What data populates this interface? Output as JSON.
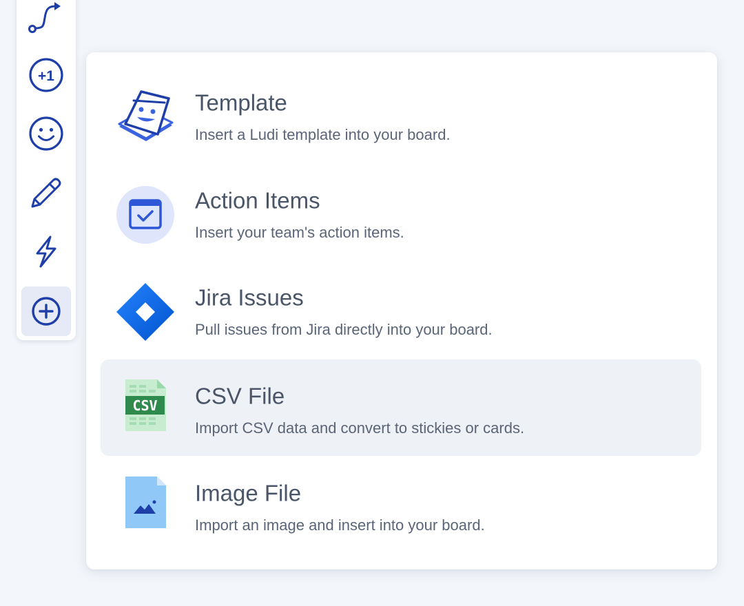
{
  "toolbar": {
    "tools": [
      {
        "name": "connector",
        "icon": "connector-arrow-icon",
        "active": false
      },
      {
        "name": "vote",
        "icon": "plus-one-icon",
        "label": "+1",
        "active": false
      },
      {
        "name": "emoji",
        "icon": "smiley-icon",
        "active": false
      },
      {
        "name": "draw",
        "icon": "pencil-icon",
        "active": false
      },
      {
        "name": "actions",
        "icon": "lightning-bolt-icon",
        "active": false
      },
      {
        "name": "insert",
        "icon": "plus-circle-icon",
        "active": true
      }
    ]
  },
  "menu": {
    "items": [
      {
        "id": "template",
        "icon": "template-sticky-icon",
        "title": "Template",
        "description": "Insert a Ludi template into your board."
      },
      {
        "id": "action-items",
        "icon": "calendar-check-icon",
        "title": "Action Items",
        "description": "Insert your team's action items."
      },
      {
        "id": "jira-issues",
        "icon": "jira-logo-icon",
        "title": "Jira Issues",
        "description": "Pull issues from Jira directly into your board."
      },
      {
        "id": "csv-file",
        "icon": "csv-file-icon",
        "icon_label": "CSV",
        "title": "CSV File",
        "description": "Import CSV data and convert to stickies or cards.",
        "highlighted": true
      },
      {
        "id": "image-file",
        "icon": "image-file-icon",
        "title": "Image File",
        "description": "Import an image and insert into your board."
      }
    ]
  },
  "colors": {
    "accent": "#1e3ea8",
    "background": "#f3f6fa",
    "highlight": "#eef1f5",
    "jira": "#2684ff",
    "csv_green": "#2f8a4e",
    "image_blue": "#90c8f8"
  }
}
